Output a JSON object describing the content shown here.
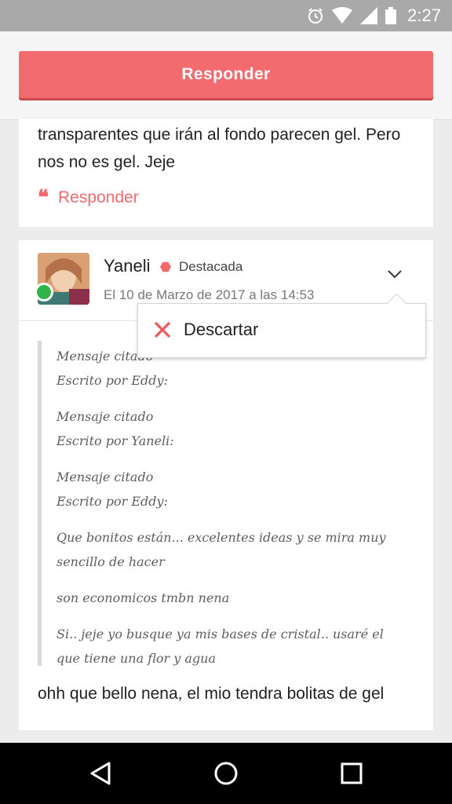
{
  "status_bar": {
    "time": "2:27"
  },
  "top_bar": {
    "respond_label": "Responder"
  },
  "previous_comment": {
    "text": "transparentes que irán al fondo parecen gel. Pero nos no es gel. Jeje",
    "reply_label": "Responder"
  },
  "comment": {
    "author": "Yaneli",
    "badge": "Destacada",
    "date": "El 10 de Marzo de 2017 a las 14:53",
    "quote_lines": [
      "Mensaje citado\nEscrito por Eddy:",
      "Mensaje citado\nEscrito por Yaneli:",
      "Mensaje citado\nEscrito por Eddy:",
      "Que bonitos están... excelentes ideas y se mira muy sencillo de hacer",
      "son economicos tmbn nena",
      "Si.. jeje yo busque ya mis bases de cristal.. usaré el que tiene una flor y agua"
    ],
    "text": "ohh que bello nena, el mio tendra bolitas de gel"
  },
  "dropdown": {
    "discard_label": "Descartar"
  },
  "colors": {
    "accent": "#f26b6f",
    "online": "#2fb44a"
  }
}
